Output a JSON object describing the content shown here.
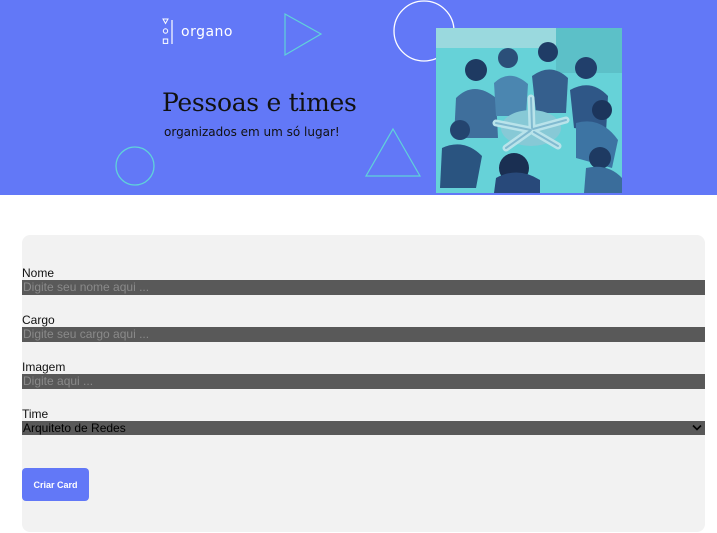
{
  "banner": {
    "logo_text": "organo",
    "headline": "Pessoas e times",
    "subheadline": "organizados em um só lugar!",
    "photo_alt": "Pessoas unindo as mãos",
    "background_color": "#6278f7",
    "photo_tint": "#60d3d9"
  },
  "form": {
    "fields": [
      {
        "label": "Nome",
        "placeholder": "Digite seu nome aqui ...",
        "value": ""
      },
      {
        "label": "Cargo",
        "placeholder": "Digite seu cargo aqui ...",
        "value": ""
      },
      {
        "label": "Imagem",
        "placeholder": "Digite aqui ...",
        "value": ""
      }
    ],
    "team_select": {
      "label": "Time",
      "selected": "Arquiteto de Redes"
    },
    "submit_label": "Criar Card"
  }
}
